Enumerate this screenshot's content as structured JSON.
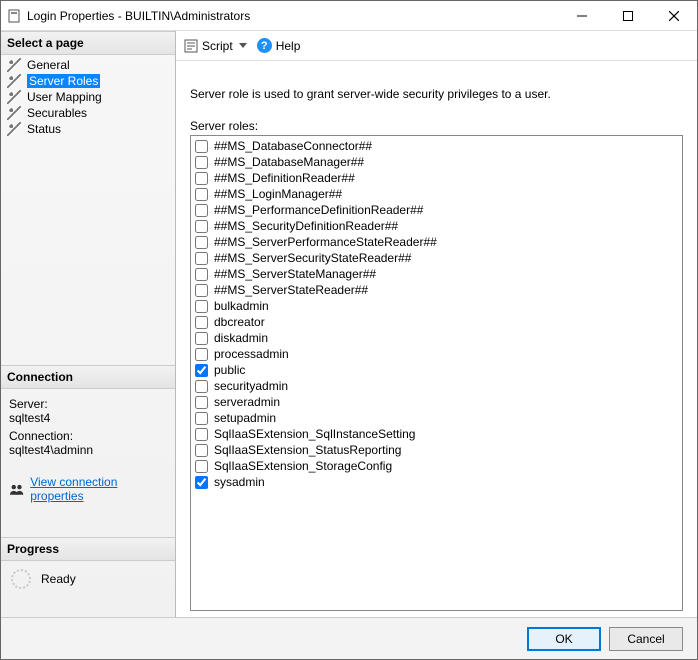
{
  "window": {
    "title": "Login Properties - BUILTIN\\Administrators"
  },
  "nav": {
    "header": "Select a page",
    "items": [
      {
        "label": "General"
      },
      {
        "label": "Server Roles"
      },
      {
        "label": "User Mapping"
      },
      {
        "label": "Securables"
      },
      {
        "label": "Status"
      }
    ],
    "selected_index": 1
  },
  "connection": {
    "header": "Connection",
    "server_label": "Server:",
    "server": "sqltest4",
    "conn_label": "Connection:",
    "conn": "sqltest4\\adminn",
    "link": "View connection properties"
  },
  "progress": {
    "header": "Progress",
    "status": "Ready"
  },
  "toolbar": {
    "script": "Script",
    "help": "Help"
  },
  "main": {
    "description": "Server role is used to grant server-wide security privileges to a user.",
    "roles_label": "Server roles:",
    "roles": [
      {
        "name": "##MS_DatabaseConnector##",
        "checked": false
      },
      {
        "name": "##MS_DatabaseManager##",
        "checked": false
      },
      {
        "name": "##MS_DefinitionReader##",
        "checked": false
      },
      {
        "name": "##MS_LoginManager##",
        "checked": false
      },
      {
        "name": "##MS_PerformanceDefinitionReader##",
        "checked": false
      },
      {
        "name": "##MS_SecurityDefinitionReader##",
        "checked": false
      },
      {
        "name": "##MS_ServerPerformanceStateReader##",
        "checked": false
      },
      {
        "name": "##MS_ServerSecurityStateReader##",
        "checked": false
      },
      {
        "name": "##MS_ServerStateManager##",
        "checked": false
      },
      {
        "name": "##MS_ServerStateReader##",
        "checked": false
      },
      {
        "name": "bulkadmin",
        "checked": false
      },
      {
        "name": "dbcreator",
        "checked": false
      },
      {
        "name": "diskadmin",
        "checked": false
      },
      {
        "name": "processadmin",
        "checked": false
      },
      {
        "name": "public",
        "checked": true
      },
      {
        "name": "securityadmin",
        "checked": false
      },
      {
        "name": "serveradmin",
        "checked": false
      },
      {
        "name": "setupadmin",
        "checked": false
      },
      {
        "name": "SqlIaaSExtension_SqlInstanceSetting",
        "checked": false
      },
      {
        "name": "SqlIaaSExtension_StatusReporting",
        "checked": false
      },
      {
        "name": "SqlIaaSExtension_StorageConfig",
        "checked": false
      },
      {
        "name": "sysadmin",
        "checked": true
      }
    ]
  },
  "buttons": {
    "ok": "OK",
    "cancel": "Cancel"
  }
}
